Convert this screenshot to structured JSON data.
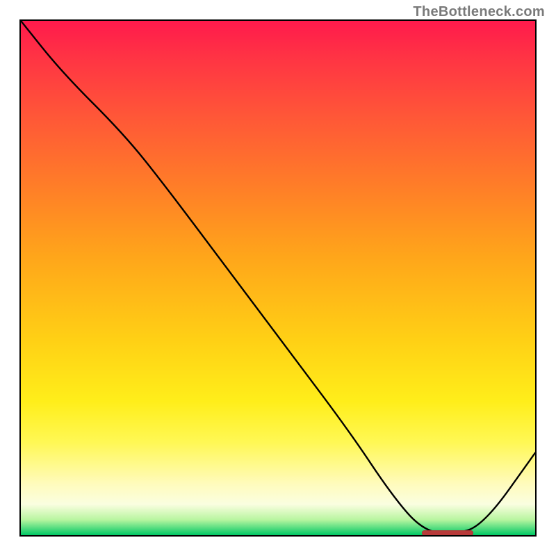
{
  "attribution": "TheBottleneck.com",
  "chart_data": {
    "type": "line",
    "title": "",
    "xlabel": "",
    "ylabel": "",
    "xlim": [
      0,
      100
    ],
    "ylim": [
      0,
      100
    ],
    "grid": false,
    "legend": false,
    "series": [
      {
        "name": "bottleneck-curve",
        "x": [
          0,
          8,
          20,
          28,
          40,
          52,
          64,
          72,
          78,
          84,
          90,
          100
        ],
        "y": [
          100,
          90,
          78,
          68,
          52,
          36,
          20,
          8,
          1,
          0,
          2,
          16
        ]
      }
    ],
    "minimum_region": {
      "x_start": 78,
      "x_end": 88,
      "y": 0
    },
    "background_scheme": "red-to-green-vertical"
  }
}
